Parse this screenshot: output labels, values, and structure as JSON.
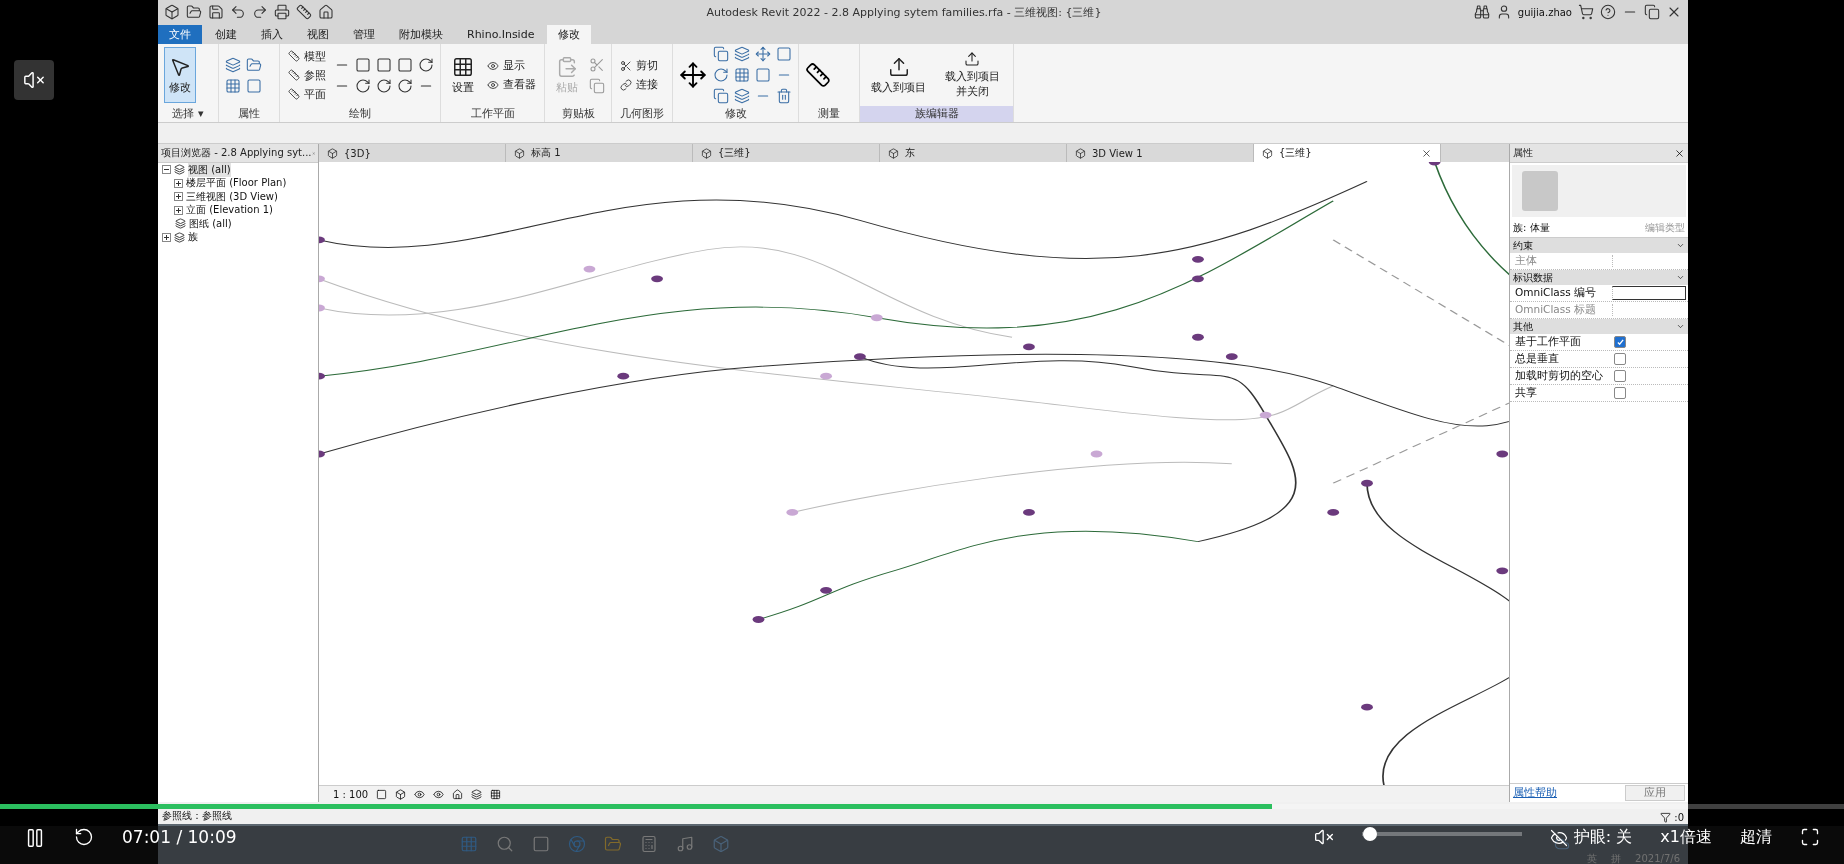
{
  "window": {
    "title": "Autodesk Revit 2022 - 2.8 Applying sytem families.rfa - 三维视图: {三维}",
    "user": "guijia.zhao"
  },
  "ribbon_tabs": [
    {
      "label": "文件",
      "kind": "file",
      "selected": false
    },
    {
      "label": "创建",
      "kind": "tab",
      "selected": false
    },
    {
      "label": "插入",
      "kind": "tab",
      "selected": false
    },
    {
      "label": "视图",
      "kind": "tab",
      "selected": false
    },
    {
      "label": "管理",
      "kind": "tab",
      "selected": false
    },
    {
      "label": "附加模块",
      "kind": "tab",
      "selected": false
    },
    {
      "label": "Rhino.Inside",
      "kind": "tab",
      "selected": false
    },
    {
      "label": "修改",
      "kind": "tab",
      "selected": true
    }
  ],
  "ribbon_panels": [
    {
      "title": "选择 ▾",
      "tools": [
        {
          "label": "修改",
          "kind": "big",
          "selected": true
        }
      ]
    },
    {
      "title": "属性"
    },
    {
      "title": "绘制",
      "tools": [
        {
          "label": "模型",
          "kind": "small"
        },
        {
          "label": "参照",
          "kind": "small"
        },
        {
          "label": "平面",
          "kind": "small"
        }
      ]
    },
    {
      "title": "工作平面",
      "tools": [
        {
          "label": "设置",
          "kind": "big"
        },
        {
          "label": "显示",
          "kind": "small"
        },
        {
          "label": "查看器",
          "kind": "small"
        }
      ]
    },
    {
      "title": "剪贴板",
      "tools": [
        {
          "label": "粘贴",
          "kind": "big",
          "disabled": true
        }
      ]
    },
    {
      "title": "几何图形",
      "tools": [
        {
          "label": "剪切",
          "kind": "small"
        },
        {
          "label": "连接",
          "kind": "small"
        }
      ]
    },
    {
      "title": "修改"
    },
    {
      "title": "测量"
    },
    {
      "title": "族编辑器",
      "tools": [
        {
          "label": "载入到项目",
          "kind": "big"
        },
        {
          "label": "载入到项目并关闭",
          "kind": "big"
        }
      ]
    }
  ],
  "project_browser": {
    "title": "项目浏览器 - 2.8 Applying syt...",
    "tree": [
      {
        "label": "视图 (all)",
        "selected": true,
        "expanded": true,
        "children": [
          {
            "label": "楼层平面 (Floor Plan)",
            "selected": false,
            "expanded": false
          },
          {
            "label": "三维视图 (3D View)",
            "selected": false,
            "expanded": false
          },
          {
            "label": "立面 (Elevation 1)",
            "selected": false,
            "expanded": false
          }
        ]
      },
      {
        "label": "图纸 (all)",
        "selected": false
      },
      {
        "label": "族",
        "selected": false,
        "expanded": false
      }
    ]
  },
  "view_tabs": [
    {
      "label": "{3D}",
      "selected": false
    },
    {
      "label": "标高 1",
      "selected": false
    },
    {
      "label": "{三维}",
      "selected": false
    },
    {
      "label": "东",
      "selected": false
    },
    {
      "label": "3D View 1",
      "selected": false
    },
    {
      "label": "{三维}",
      "selected": true
    }
  ],
  "view_bar": {
    "scale": "1 : 100"
  },
  "properties": {
    "title": "属性",
    "type_selector": "族: 体量",
    "edit_type": "编辑类型",
    "groups": [
      {
        "title": "约束",
        "rows": [
          {
            "label": "主体",
            "kind": "text",
            "disabled": true
          }
        ]
      },
      {
        "title": "标识数据",
        "rows": [
          {
            "label": "OmniClass 编号",
            "kind": "text",
            "disabled": false
          },
          {
            "label": "OmniClass 标题",
            "kind": "text",
            "disabled": true
          }
        ]
      },
      {
        "title": "其他",
        "rows": [
          {
            "label": "基于工作平面",
            "kind": "checkbox",
            "checked": true
          },
          {
            "label": "总是垂直",
            "kind": "checkbox",
            "checked": false
          },
          {
            "label": "加载时剪切的空心",
            "kind": "checkbox",
            "checked": false
          },
          {
            "label": "共享",
            "kind": "checkbox",
            "checked": false
          }
        ]
      }
    ],
    "help_link": "属性帮助",
    "apply_button": "应用"
  },
  "status_bar": {
    "text": "参照线：参照线",
    "filter": ":0"
  },
  "taskbar": {
    "ime": [
      "英",
      "拼"
    ],
    "date": "2021/7/6"
  },
  "player": {
    "muted": true,
    "time": "07:01 / 10:09",
    "level": 0.69,
    "volume": {
      "level": 0.02
    },
    "eye_care": "护眼: 关",
    "speed": "x1倍速",
    "quality": "超清"
  }
}
